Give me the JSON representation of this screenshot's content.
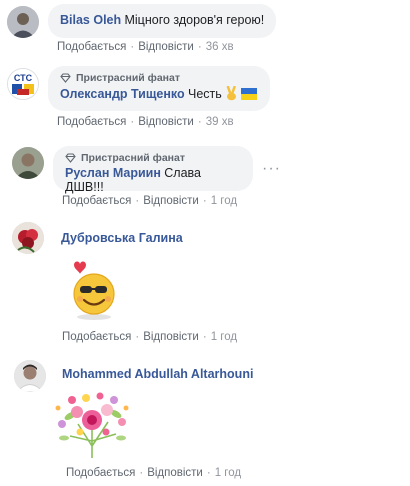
{
  "comments": [
    {
      "author": "Bilas Oleh",
      "text": "Міцного здоров'я герою!",
      "like": "Подобається",
      "reply": "Відповісти",
      "time": "36 хв",
      "avatar": "avatar"
    },
    {
      "badge": "Пристрасний фанат",
      "author": "Олександр Тищенко",
      "text": "Честь",
      "emoji": [
        "victory-hand-emoji",
        "ukraine-flag-emoji"
      ],
      "like": "Подобається",
      "reply": "Відповісти",
      "time": "39 хв",
      "avatar": "page-logo-avatar"
    },
    {
      "badge": "Пристрасний фанат",
      "author": "Руслан Мариин",
      "text": "Слава ДШВ!!!",
      "like": "Подобається",
      "reply": "Відповісти",
      "time": "1 год",
      "avatar": "avatar"
    },
    {
      "author": "Дубровська Галина",
      "sticker": "smiley-with-heart-sticker",
      "like": "Подобається",
      "reply": "Відповісти",
      "time": "1 год",
      "avatar": "avatar"
    },
    {
      "author": "Mohammed Abdullah Altarhouni",
      "sticker": "flower-bouquet-sticker",
      "like": "Подобається",
      "reply": "Відповісти",
      "time": "1 год",
      "avatar": "avatar"
    }
  ],
  "colors": {
    "author": "#385898",
    "bubble": "#f2f3f5",
    "meta": "#606770",
    "time": "#90949c"
  }
}
